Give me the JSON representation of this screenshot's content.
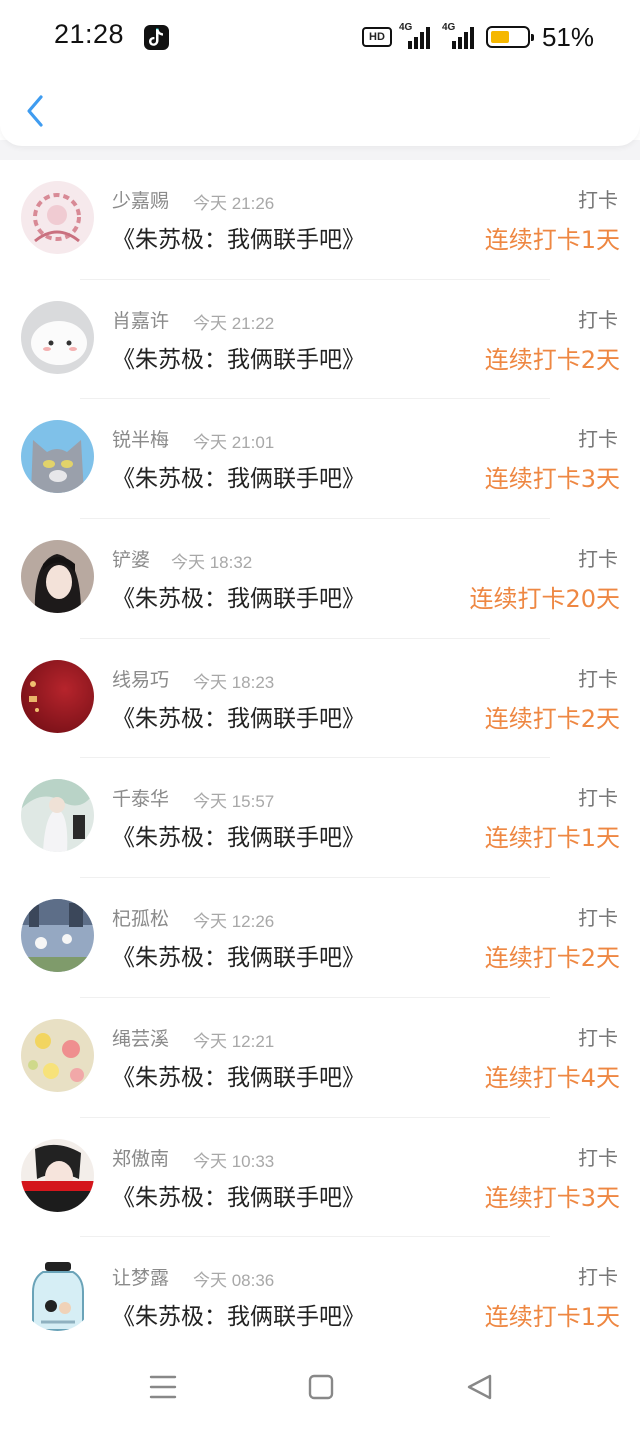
{
  "status_bar": {
    "time": "21:28",
    "hd_badge": "HD",
    "net1": "4G",
    "net2": "4G",
    "battery_percent": "51%",
    "battery_level": 0.51,
    "icons": [
      "tiktok-icon",
      "hd-icon",
      "signal-icon",
      "signal-icon",
      "battery-icon"
    ]
  },
  "header": {
    "back_icon": "chevron-left-icon",
    "accent_color": "#3f9cf0"
  },
  "colors": {
    "streak": "#ee8742",
    "name": "#8a8a8a",
    "time": "#a8a8a8"
  },
  "entries": [
    {
      "name": "少嘉赐",
      "time": "今天 21:26",
      "book": "《朱苏极：我俩联手吧》",
      "type": "打卡",
      "streak": "连续打卡1天"
    },
    {
      "name": "肖嘉许",
      "time": "今天 21:22",
      "book": "《朱苏极：我俩联手吧》",
      "type": "打卡",
      "streak": "连续打卡2天"
    },
    {
      "name": "锐半梅",
      "time": "今天 21:01",
      "book": "《朱苏极：我俩联手吧》",
      "type": "打卡",
      "streak": "连续打卡3天"
    },
    {
      "name": "铲婆",
      "time": "今天 18:32",
      "book": "《朱苏极：我俩联手吧》",
      "type": "打卡",
      "streak": "连续打卡20天"
    },
    {
      "name": "线易巧",
      "time": "今天 18:23",
      "book": "《朱苏极：我俩联手吧》",
      "type": "打卡",
      "streak": "连续打卡2天"
    },
    {
      "name": "千泰华",
      "time": "今天 15:57",
      "book": "《朱苏极：我俩联手吧》",
      "type": "打卡",
      "streak": "连续打卡1天"
    },
    {
      "name": "杞孤松",
      "time": "今天 12:26",
      "book": "《朱苏极：我俩联手吧》",
      "type": "打卡",
      "streak": "连续打卡2天"
    },
    {
      "name": "绳芸溪",
      "time": "今天 12:21",
      "book": "《朱苏极：我俩联手吧》",
      "type": "打卡",
      "streak": "连续打卡4天"
    },
    {
      "name": "郑傲南",
      "time": "今天 10:33",
      "book": "《朱苏极：我俩联手吧》",
      "type": "打卡",
      "streak": "连续打卡3天"
    },
    {
      "name": "让梦露",
      "time": "今天 08:36",
      "book": "《朱苏极：我俩联手吧》",
      "type": "打卡",
      "streak": "连续打卡1天"
    }
  ],
  "nav_bar": {
    "icons": [
      "menu-icon",
      "home-icon",
      "back-triangle-icon"
    ]
  }
}
